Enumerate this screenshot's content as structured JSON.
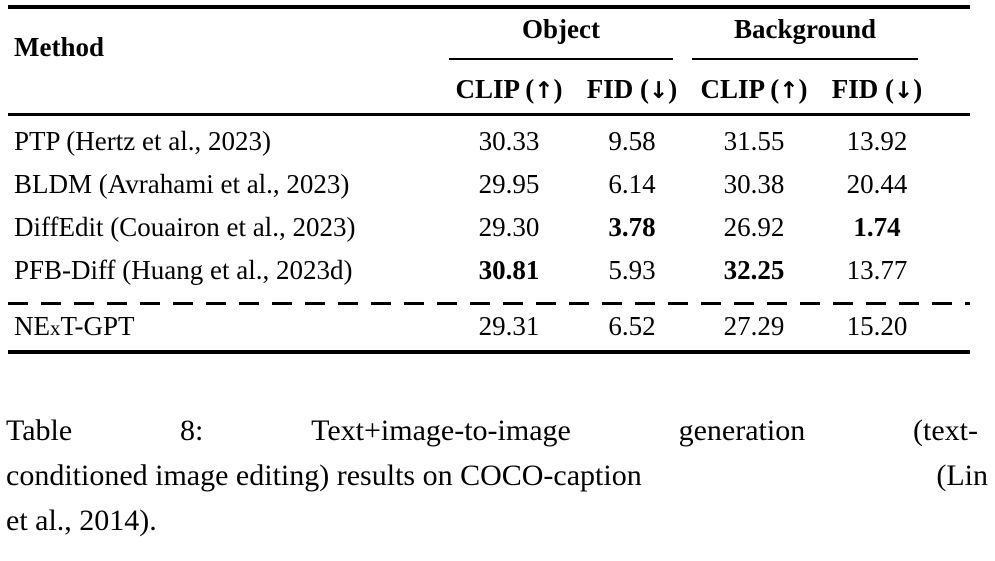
{
  "table": {
    "id": "Table 8",
    "method_header": "Method",
    "groups": [
      {
        "label": "Object"
      },
      {
        "label": "Background"
      }
    ],
    "metric_headers": [
      {
        "name": "CLIP",
        "arrow": "↑"
      },
      {
        "name": "FID",
        "arrow": "↓"
      },
      {
        "name": "CLIP",
        "arrow": "↑"
      },
      {
        "name": "FID",
        "arrow": "↓"
      }
    ],
    "rows": [
      {
        "method": "PTP (Hertz et al., 2023)",
        "object_clip": "30.33",
        "object_fid": "9.58",
        "background_clip": "31.55",
        "background_fid": "13.92",
        "bold": []
      },
      {
        "method": "BLDM (Avrahami et al., 2023)",
        "object_clip": "29.95",
        "object_fid": "6.14",
        "background_clip": "30.38",
        "background_fid": "20.44",
        "bold": []
      },
      {
        "method": "DiffEdit (Couairon et al., 2023)",
        "object_clip": "29.30",
        "object_fid": "3.78",
        "background_clip": "26.92",
        "background_fid": "1.74",
        "bold": [
          "object_fid",
          "background_fid"
        ]
      },
      {
        "method": "PFB-Diff (Huang et al., 2023d)",
        "object_clip": "30.81",
        "object_fid": "5.93",
        "background_clip": "32.25",
        "background_fid": "13.77",
        "bold": [
          "object_clip",
          "background_clip"
        ]
      },
      {
        "method_prefix": "NE",
        "method_smallcap": "x",
        "method_suffix": "T-GPT",
        "method": "NExT-GPT",
        "object_clip": "29.31",
        "object_fid": "6.52",
        "background_clip": "27.29",
        "background_fid": "15.20",
        "bold": []
      }
    ]
  },
  "caption": {
    "label": "Table 8:",
    "line1_part1": "Table",
    "line1_part2": "8:",
    "line1_part3": "Text+image-to-image",
    "line1_part4": "generation",
    "line1_part5": "(text-",
    "line2_part1": "conditioned image editing) results on COCO-caption",
    "line2_part2": "(Lin",
    "line3": "et al., 2014).",
    "full_text": "Table 8: Text+image-to-image generation (text-conditioned image editing) results on COCO-caption (Lin et al., 2014)."
  },
  "chart_data": {
    "type": "table",
    "title": "Table 8: Text+image-to-image generation (text-conditioned image editing) results on COCO-caption (Lin et al., 2014).",
    "column_groups": [
      "Object",
      "Background"
    ],
    "columns": [
      "Method",
      "Object CLIP (↑)",
      "Object FID (↓)",
      "Background CLIP (↑)",
      "Background FID (↓)"
    ],
    "rows": [
      [
        "PTP (Hertz et al., 2023)",
        30.33,
        9.58,
        31.55,
        13.92
      ],
      [
        "BLDM (Avrahami et al., 2023)",
        29.95,
        6.14,
        30.38,
        20.44
      ],
      [
        "DiffEdit (Couairon et al., 2023)",
        29.3,
        3.78,
        26.92,
        1.74
      ],
      [
        "PFB-Diff (Huang et al., 2023d)",
        30.81,
        5.93,
        32.25,
        13.77
      ],
      [
        "NExT-GPT",
        29.31,
        6.52,
        27.29,
        15.2
      ]
    ],
    "bold_cells": [
      [
        2,
        2
      ],
      [
        2,
        4
      ],
      [
        3,
        1
      ],
      [
        3,
        3
      ]
    ],
    "separator_after_row": 3
  }
}
